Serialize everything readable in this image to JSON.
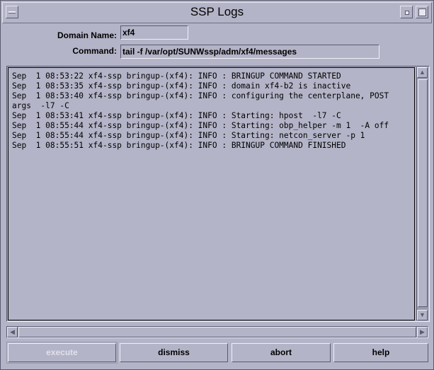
{
  "window": {
    "title": "SSP Logs"
  },
  "form": {
    "domain_label": "Domain Name:",
    "domain_value": "xf4",
    "command_label": "Command:",
    "command_value": "tail -f /var/opt/SUNWssp/adm/xf4/messages"
  },
  "log": {
    "lines": [
      "Sep  1 08:53:22 xf4-ssp bringup-(xf4): INFO : BRINGUP COMMAND STARTED",
      "Sep  1 08:53:35 xf4-ssp bringup-(xf4): INFO : domain xf4-b2 is inactive",
      "Sep  1 08:53:40 xf4-ssp bringup-(xf4): INFO : configuring the centerplane, POST",
      "args  -l7 -C",
      "Sep  1 08:53:41 xf4-ssp bringup-(xf4): INFO : Starting: hpost  -l7 -C",
      "Sep  1 08:55:44 xf4-ssp bringup-(xf4): INFO : Starting: obp_helper -m 1  -A off",
      "Sep  1 08:55:44 xf4-ssp bringup-(xf4): INFO : Starting: netcon_server -p 1",
      "Sep  1 08:55:51 xf4-ssp bringup-(xf4): INFO : BRINGUP COMMAND FINISHED"
    ]
  },
  "buttons": {
    "execute": "execute",
    "dismiss": "dismiss",
    "abort": "abort",
    "help": "help"
  },
  "icons": {
    "window_menu": "window-menu-icon",
    "minimize": "minimize-icon",
    "maximize": "maximize-icon",
    "arrow_up": "arrow-up-icon",
    "arrow_down": "arrow-down-icon",
    "arrow_left": "arrow-left-icon",
    "arrow_right": "arrow-right-icon"
  },
  "colors": {
    "background": "#b4b4c8",
    "disabled_text": "#e0e0ec"
  }
}
